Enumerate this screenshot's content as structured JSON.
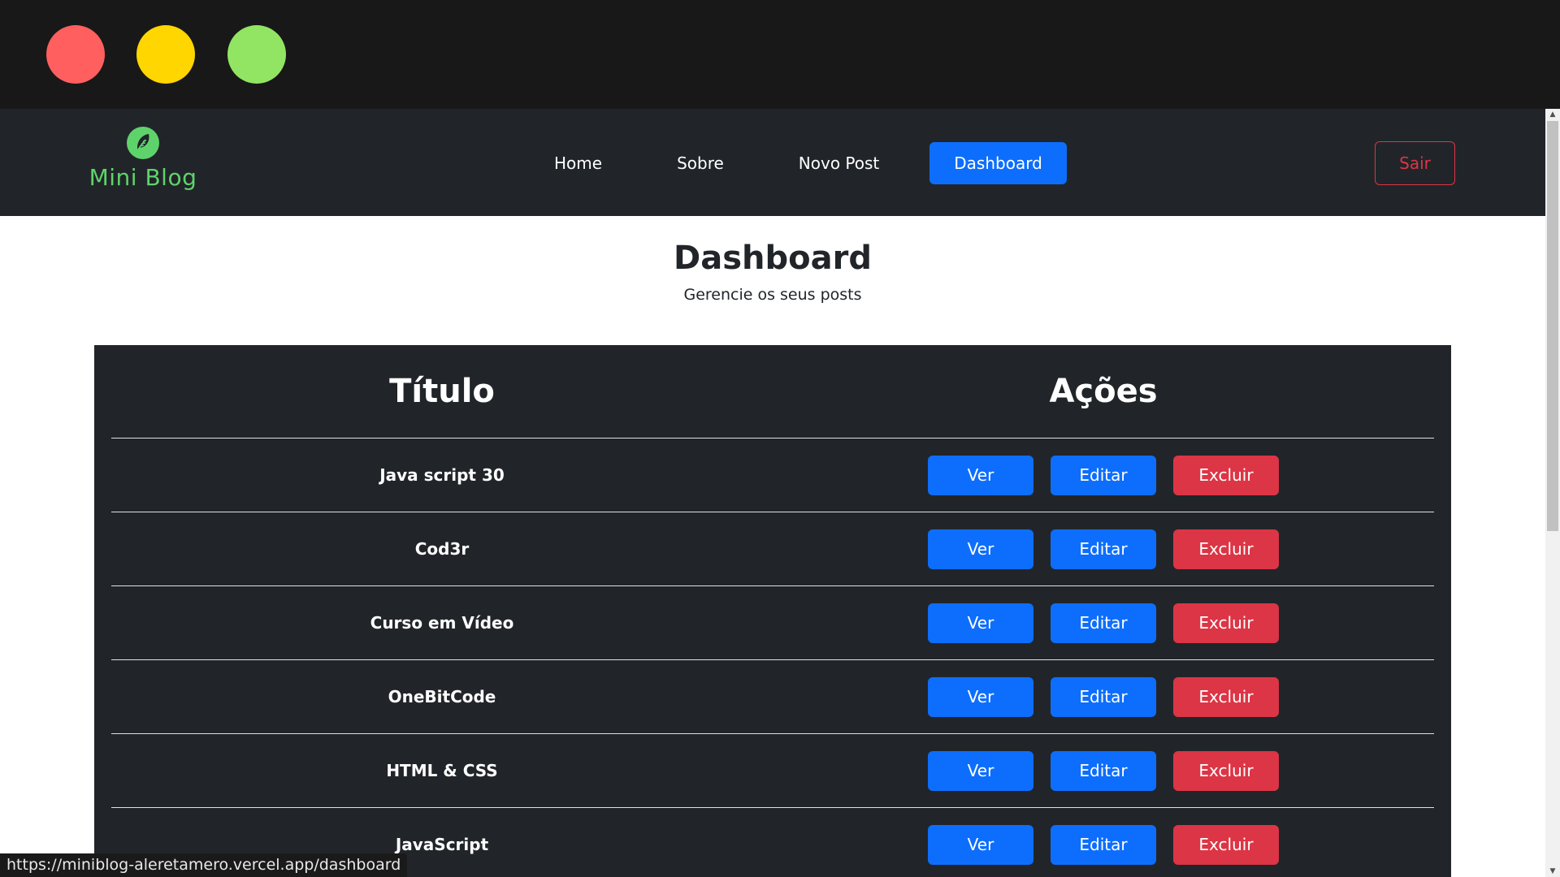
{
  "window": {
    "controls": [
      "close",
      "minimize",
      "maximize"
    ]
  },
  "navbar": {
    "brand_text": "Mini Blog",
    "brand_icon": "feather-icon",
    "links": [
      {
        "label": "Home"
      },
      {
        "label": "Sobre"
      },
      {
        "label": "Novo Post"
      },
      {
        "label": "Dashboard",
        "active": true
      }
    ],
    "logout_label": "Sair"
  },
  "page": {
    "title": "Dashboard",
    "subtitle": "Gerencie os seus posts"
  },
  "table": {
    "headers": [
      "Título",
      "Ações"
    ],
    "rows": [
      {
        "title": "Java script 30"
      },
      {
        "title": "Cod3r"
      },
      {
        "title": "Curso em Vídeo"
      },
      {
        "title": "OneBitCode"
      },
      {
        "title": "HTML & CSS"
      },
      {
        "title": "JavaScript"
      }
    ],
    "actions": {
      "view": "Ver",
      "edit": "Editar",
      "delete": "Excluir"
    }
  },
  "statusbar": {
    "url": "https://miniblog-aleretamero.vercel.app/dashboard"
  },
  "colors": {
    "primary": "#0d6efd",
    "danger": "#dc3545",
    "dark": "#212529",
    "brand": "#5fd36b"
  }
}
